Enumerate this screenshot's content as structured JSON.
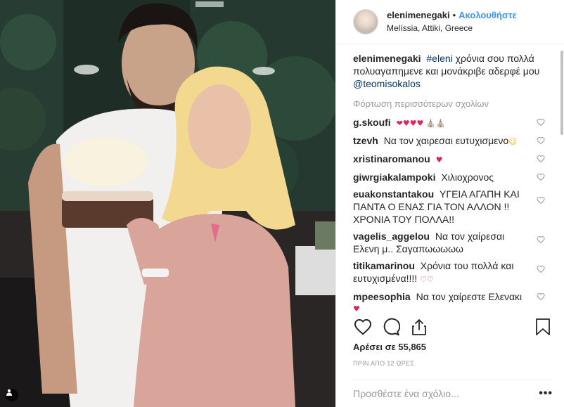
{
  "post": {
    "username": "elenimenegaki",
    "dot": "•",
    "follow_label": "Ακολουθήστε",
    "location": "Melíssia, Attiki, Greece"
  },
  "caption": {
    "username": "elenimenegaki",
    "hashtag": "#eleni",
    "text": "χρόνια σου πολλά πολυαγαπημενε και μονάκριβε αδερφέ μου",
    "mention": "@teomisokalos"
  },
  "load_more_label": "Φόρτωση περισσότερων σχολίων",
  "comments": [
    {
      "username": "g.skoufi",
      "text": "",
      "emoji": "❤♥♥♥ ⛪⛪💯"
    },
    {
      "username": "tzevh",
      "text": "Να τον χαιρεσαι ευτυχισμενο",
      "emoji": "☺"
    },
    {
      "username": "xristinaromanou",
      "text": "",
      "emoji": "♥"
    },
    {
      "username": "giwrgiakalampoki",
      "text": "Χιλιοχρονος",
      "emoji": ""
    },
    {
      "username": "euakonstantakou",
      "text": "ΥΓΕΙΑ ΑΓΑΠΗ ΚΑΙ ΠΑΝΤΑ Ο ΕΝΑΣ ΓΙΑ ΤΟΝ ΑΛΛΟΝ !! ΧΡΟΝΙΑ ΤΟΥ ΠΟΛΛΑ!!",
      "emoji": ""
    },
    {
      "username": "vagelis_aggelou",
      "text": "Να τον χαίρεσαι Ελενη μ.. Σαγαπωωωωω",
      "emoji": ""
    },
    {
      "username": "titikamarinou",
      "text": "Χρόνια του πολλά και ευτυχισμένα!!!!",
      "emoji": "♡♡"
    },
    {
      "username": "mpeesophia",
      "text": "Να τον χαίρεστε Ελενακι",
      "emoji": "♥"
    }
  ],
  "likes_label": "Αρέσει σε 55,865",
  "timestamp": "ΠΡΙΝ ΑΠΟ 12 ΩΡΕΣ",
  "add_comment_placeholder": "Προσθέστε ένα σχόλιο...",
  "more_label": "•••",
  "colors": {
    "link": "#3897f0",
    "tag": "#003569",
    "muted": "#999999",
    "heart_red": "#e0245e",
    "teal": "#2bc0c4"
  },
  "icons": [
    "heart-icon",
    "comment-icon",
    "share-icon",
    "bookmark-icon",
    "user-tag-icon",
    "like-comment-heart-icon"
  ]
}
